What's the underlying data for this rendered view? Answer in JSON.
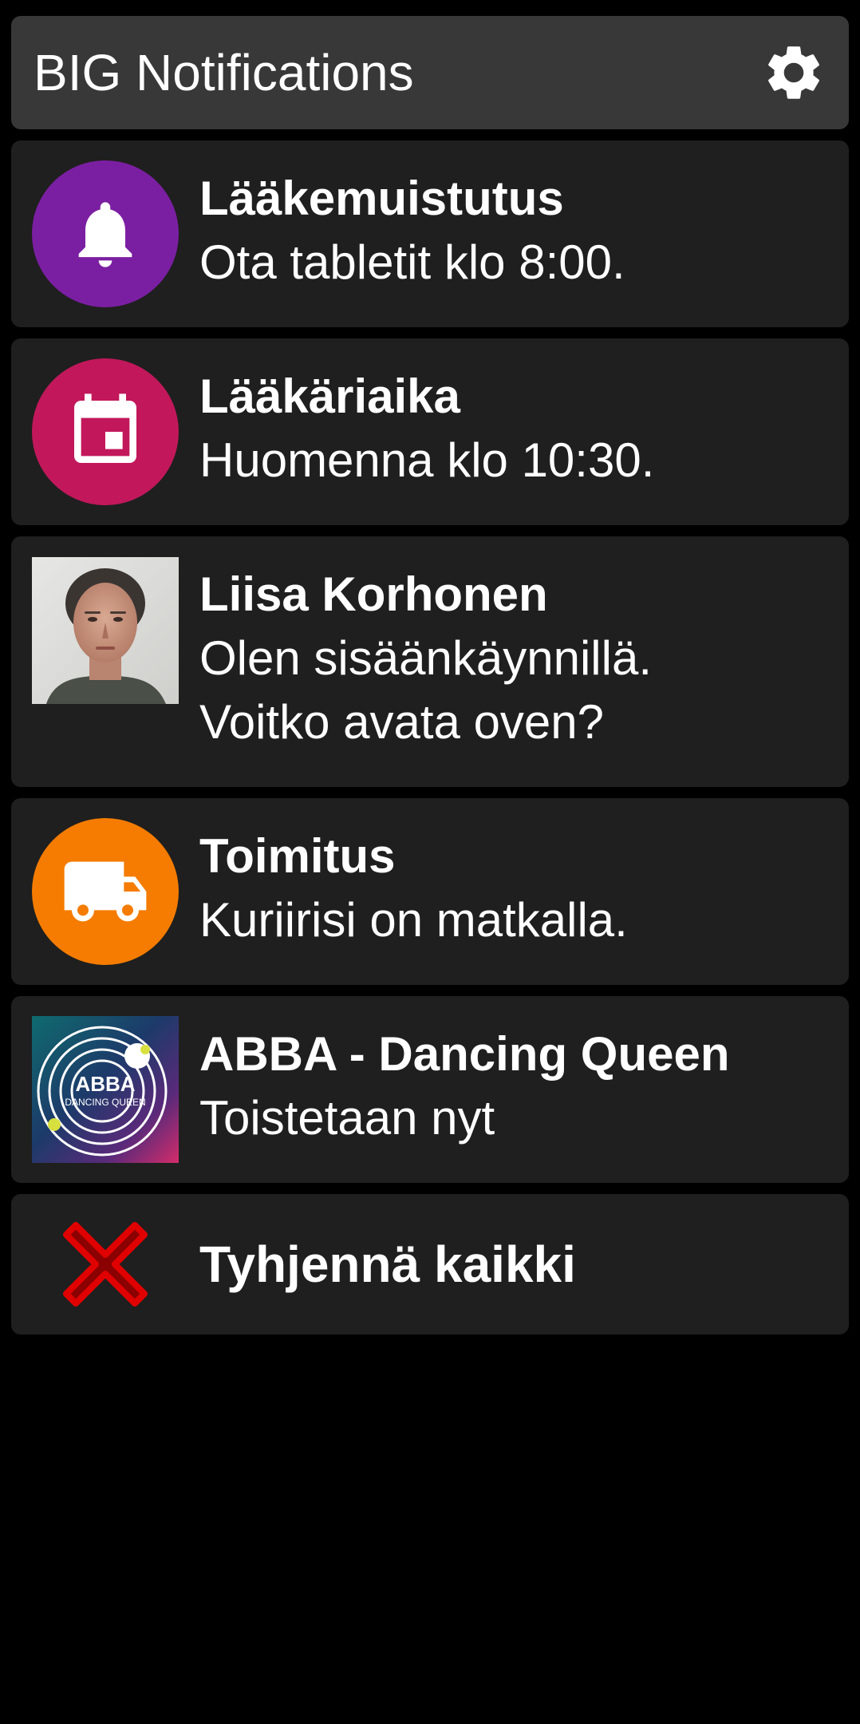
{
  "app": {
    "title": "BIG Notifications",
    "settings_icon": "gear-icon"
  },
  "notifications": [
    {
      "title": "Lääkemuistutus",
      "body": "Ota tabletit klo 8:00.",
      "icon": "bell-icon",
      "icon_bg": "#7b1fa2"
    },
    {
      "title": "Lääkäriaika",
      "body": "Huomenna klo 10:30.",
      "icon": "calendar-icon",
      "icon_bg": "#c2185b"
    },
    {
      "title": "Liisa Korhonen",
      "body_line1": "Olen sisäänkäynnillä.",
      "body_line2": "Voitko avata oven?",
      "icon": "contact-photo"
    },
    {
      "title": "Toimitus",
      "body": "Kuriirisi on matkalla.",
      "icon": "truck-icon",
      "icon_bg": "#f57c00"
    },
    {
      "title": "ABBA - Dancing Queen",
      "body": "Toistetaan nyt",
      "icon": "album-art",
      "album_art_text1": "ABBA",
      "album_art_text2": "DANCING QUEEN"
    }
  ],
  "clear_all": {
    "label": "Tyhjennä kaikki",
    "icon": "close-x-icon",
    "icon_color": "#e00000"
  },
  "colors": {
    "background": "#000000",
    "header_bg": "#383838",
    "card_bg": "#1f1f1f",
    "text": "#ffffff"
  }
}
